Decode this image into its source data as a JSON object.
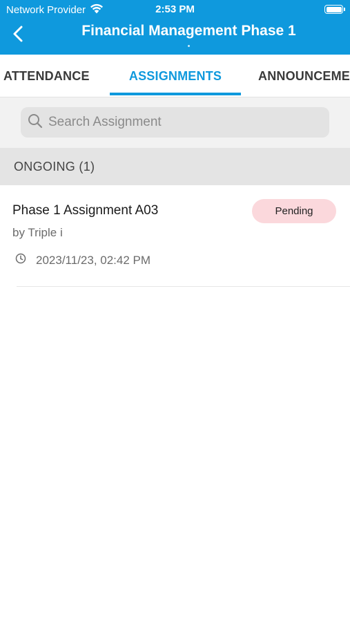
{
  "status_bar": {
    "carrier": "Network Provider",
    "time": "2:53 PM",
    "wifi_icon": "wifi-icon",
    "battery_icon": "battery-icon"
  },
  "header": {
    "title": "Financial Management Phase 1",
    "back_icon": "chevron-left-icon",
    "background_color": "#0f99dd"
  },
  "tabs": [
    {
      "label": "ATTENDANCE",
      "active": false
    },
    {
      "label": "ASSIGNMENTS",
      "active": true
    },
    {
      "label": "ANNOUNCEMENTS",
      "active": false
    }
  ],
  "search": {
    "placeholder": "Search Assignment",
    "value": "",
    "icon": "search-icon"
  },
  "section": {
    "label": "ONGOING (1)"
  },
  "assignments": [
    {
      "title": "Phase 1 Assignment A03",
      "author": "by Triple i",
      "datetime": "2023/11/23, 02:42 PM",
      "status": "Pending",
      "status_color": "#fbd8dc"
    }
  ]
}
